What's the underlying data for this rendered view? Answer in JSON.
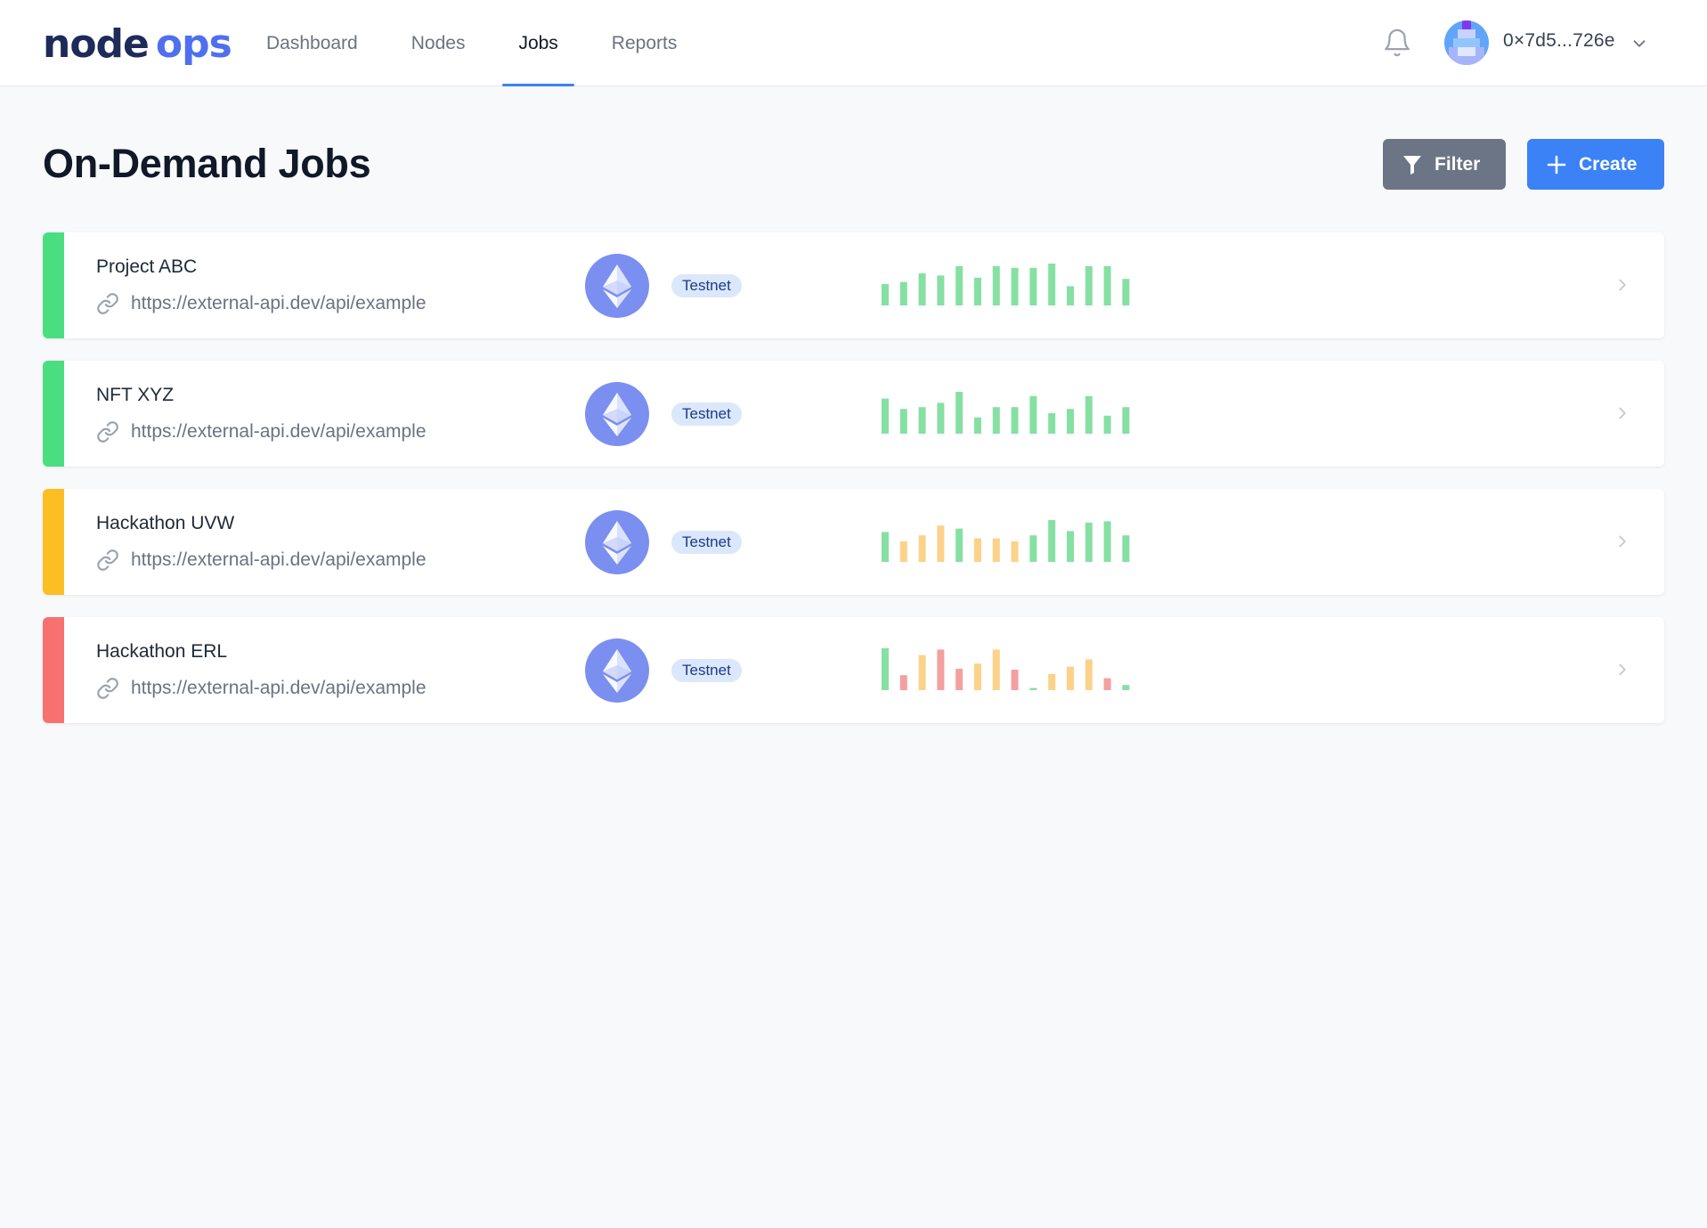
{
  "header": {
    "logo_node": "node",
    "logo_ops": "ops",
    "nav": [
      {
        "label": "Dashboard",
        "active": false
      },
      {
        "label": "Nodes",
        "active": false
      },
      {
        "label": "Jobs",
        "active": true
      },
      {
        "label": "Reports",
        "active": false
      }
    ],
    "wallet_address": "0×7d5...726e"
  },
  "page": {
    "title": "On-Demand Jobs",
    "filter_label": "Filter",
    "create_label": "Create"
  },
  "colors": {
    "accent": "#3b82f6",
    "green": "#4ade80",
    "yellow": "#fbbf24",
    "red": "#f87171",
    "bar_green": "#86e0a3",
    "bar_yellow": "#fcd28a",
    "bar_red": "#f4a0a0"
  },
  "jobs": [
    {
      "name": "Project ABC",
      "url": "https://external-api.dev/api/example",
      "network_icon": "ethereum-icon",
      "network": "Testnet",
      "status": "green",
      "bars": [
        {
          "h": 0.5,
          "c": "g"
        },
        {
          "h": 0.55,
          "c": "g"
        },
        {
          "h": 0.75,
          "c": "g"
        },
        {
          "h": 0.7,
          "c": "g"
        },
        {
          "h": 0.92,
          "c": "g"
        },
        {
          "h": 0.65,
          "c": "g"
        },
        {
          "h": 0.92,
          "c": "g"
        },
        {
          "h": 0.88,
          "c": "g"
        },
        {
          "h": 0.88,
          "c": "g"
        },
        {
          "h": 0.98,
          "c": "g"
        },
        {
          "h": 0.45,
          "c": "g"
        },
        {
          "h": 0.92,
          "c": "g"
        },
        {
          "h": 0.92,
          "c": "g"
        },
        {
          "h": 0.62,
          "c": "g"
        }
      ]
    },
    {
      "name": "NFT XYZ",
      "url": "https://external-api.dev/api/example",
      "network_icon": "ethereum-icon",
      "network": "Testnet",
      "status": "green",
      "bars": [
        {
          "h": 0.82,
          "c": "g"
        },
        {
          "h": 0.58,
          "c": "g"
        },
        {
          "h": 0.62,
          "c": "g"
        },
        {
          "h": 0.72,
          "c": "g"
        },
        {
          "h": 0.98,
          "c": "g"
        },
        {
          "h": 0.38,
          "c": "g"
        },
        {
          "h": 0.62,
          "c": "g"
        },
        {
          "h": 0.62,
          "c": "g"
        },
        {
          "h": 0.88,
          "c": "g"
        },
        {
          "h": 0.48,
          "c": "g"
        },
        {
          "h": 0.58,
          "c": "g"
        },
        {
          "h": 0.88,
          "c": "g"
        },
        {
          "h": 0.42,
          "c": "g"
        },
        {
          "h": 0.62,
          "c": "g"
        }
      ]
    },
    {
      "name": "Hackathon UVW",
      "url": "https://external-api.dev/api/example",
      "network_icon": "ethereum-icon",
      "network": "Testnet",
      "status": "yellow",
      "bars": [
        {
          "h": 0.7,
          "c": "g"
        },
        {
          "h": 0.48,
          "c": "y"
        },
        {
          "h": 0.62,
          "c": "y"
        },
        {
          "h": 0.85,
          "c": "y"
        },
        {
          "h": 0.78,
          "c": "g"
        },
        {
          "h": 0.55,
          "c": "y"
        },
        {
          "h": 0.55,
          "c": "y"
        },
        {
          "h": 0.48,
          "c": "y"
        },
        {
          "h": 0.62,
          "c": "g"
        },
        {
          "h": 0.98,
          "c": "g"
        },
        {
          "h": 0.72,
          "c": "g"
        },
        {
          "h": 0.92,
          "c": "g"
        },
        {
          "h": 0.95,
          "c": "g"
        },
        {
          "h": 0.62,
          "c": "g"
        }
      ]
    },
    {
      "name": "Hackathon ERL",
      "url": "https://external-api.dev/api/example",
      "network_icon": "ethereum-icon",
      "network": "Testnet",
      "status": "red",
      "bars": [
        {
          "h": 0.98,
          "c": "g"
        },
        {
          "h": 0.35,
          "c": "r"
        },
        {
          "h": 0.82,
          "c": "y"
        },
        {
          "h": 0.95,
          "c": "r"
        },
        {
          "h": 0.5,
          "c": "r"
        },
        {
          "h": 0.62,
          "c": "y"
        },
        {
          "h": 0.95,
          "c": "y"
        },
        {
          "h": 0.48,
          "c": "r"
        },
        {
          "h": 0.05,
          "c": "g"
        },
        {
          "h": 0.38,
          "c": "y"
        },
        {
          "h": 0.55,
          "c": "y"
        },
        {
          "h": 0.72,
          "c": "y"
        },
        {
          "h": 0.28,
          "c": "r"
        },
        {
          "h": 0.12,
          "c": "g"
        }
      ]
    }
  ]
}
